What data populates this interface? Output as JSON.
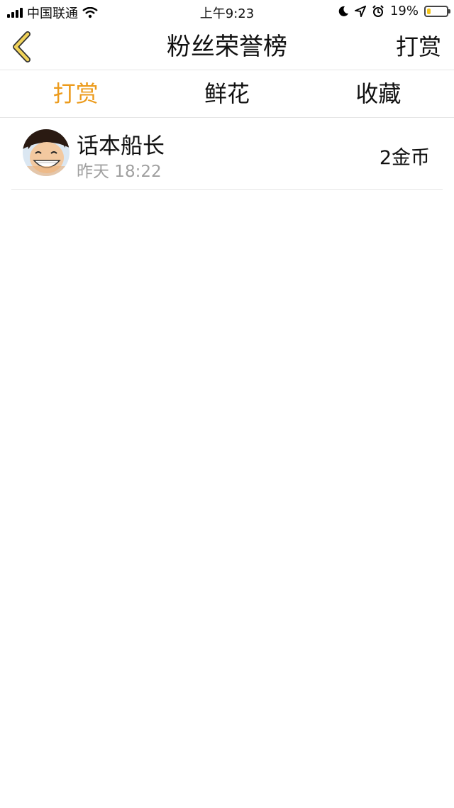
{
  "status_bar": {
    "carrier": "中国联通",
    "time": "上午9:23",
    "battery": "19%",
    "battery_level": 0.19
  },
  "nav": {
    "title": "粉丝荣誉榜",
    "right_action": "打赏",
    "back_icon": "chevron-left-icon"
  },
  "tabs": [
    {
      "label": "打赏",
      "active": true
    },
    {
      "label": "鲜花",
      "active": false
    },
    {
      "label": "收藏",
      "active": false
    }
  ],
  "list": [
    {
      "name": "话本船长",
      "time": "昨天 18:22",
      "amount": "2金币"
    }
  ],
  "colors": {
    "accent": "#ec9b1c",
    "back_icon": "#f1d35a",
    "divider": "#e6e6e6",
    "secondary_text": "#a0a0a0"
  }
}
